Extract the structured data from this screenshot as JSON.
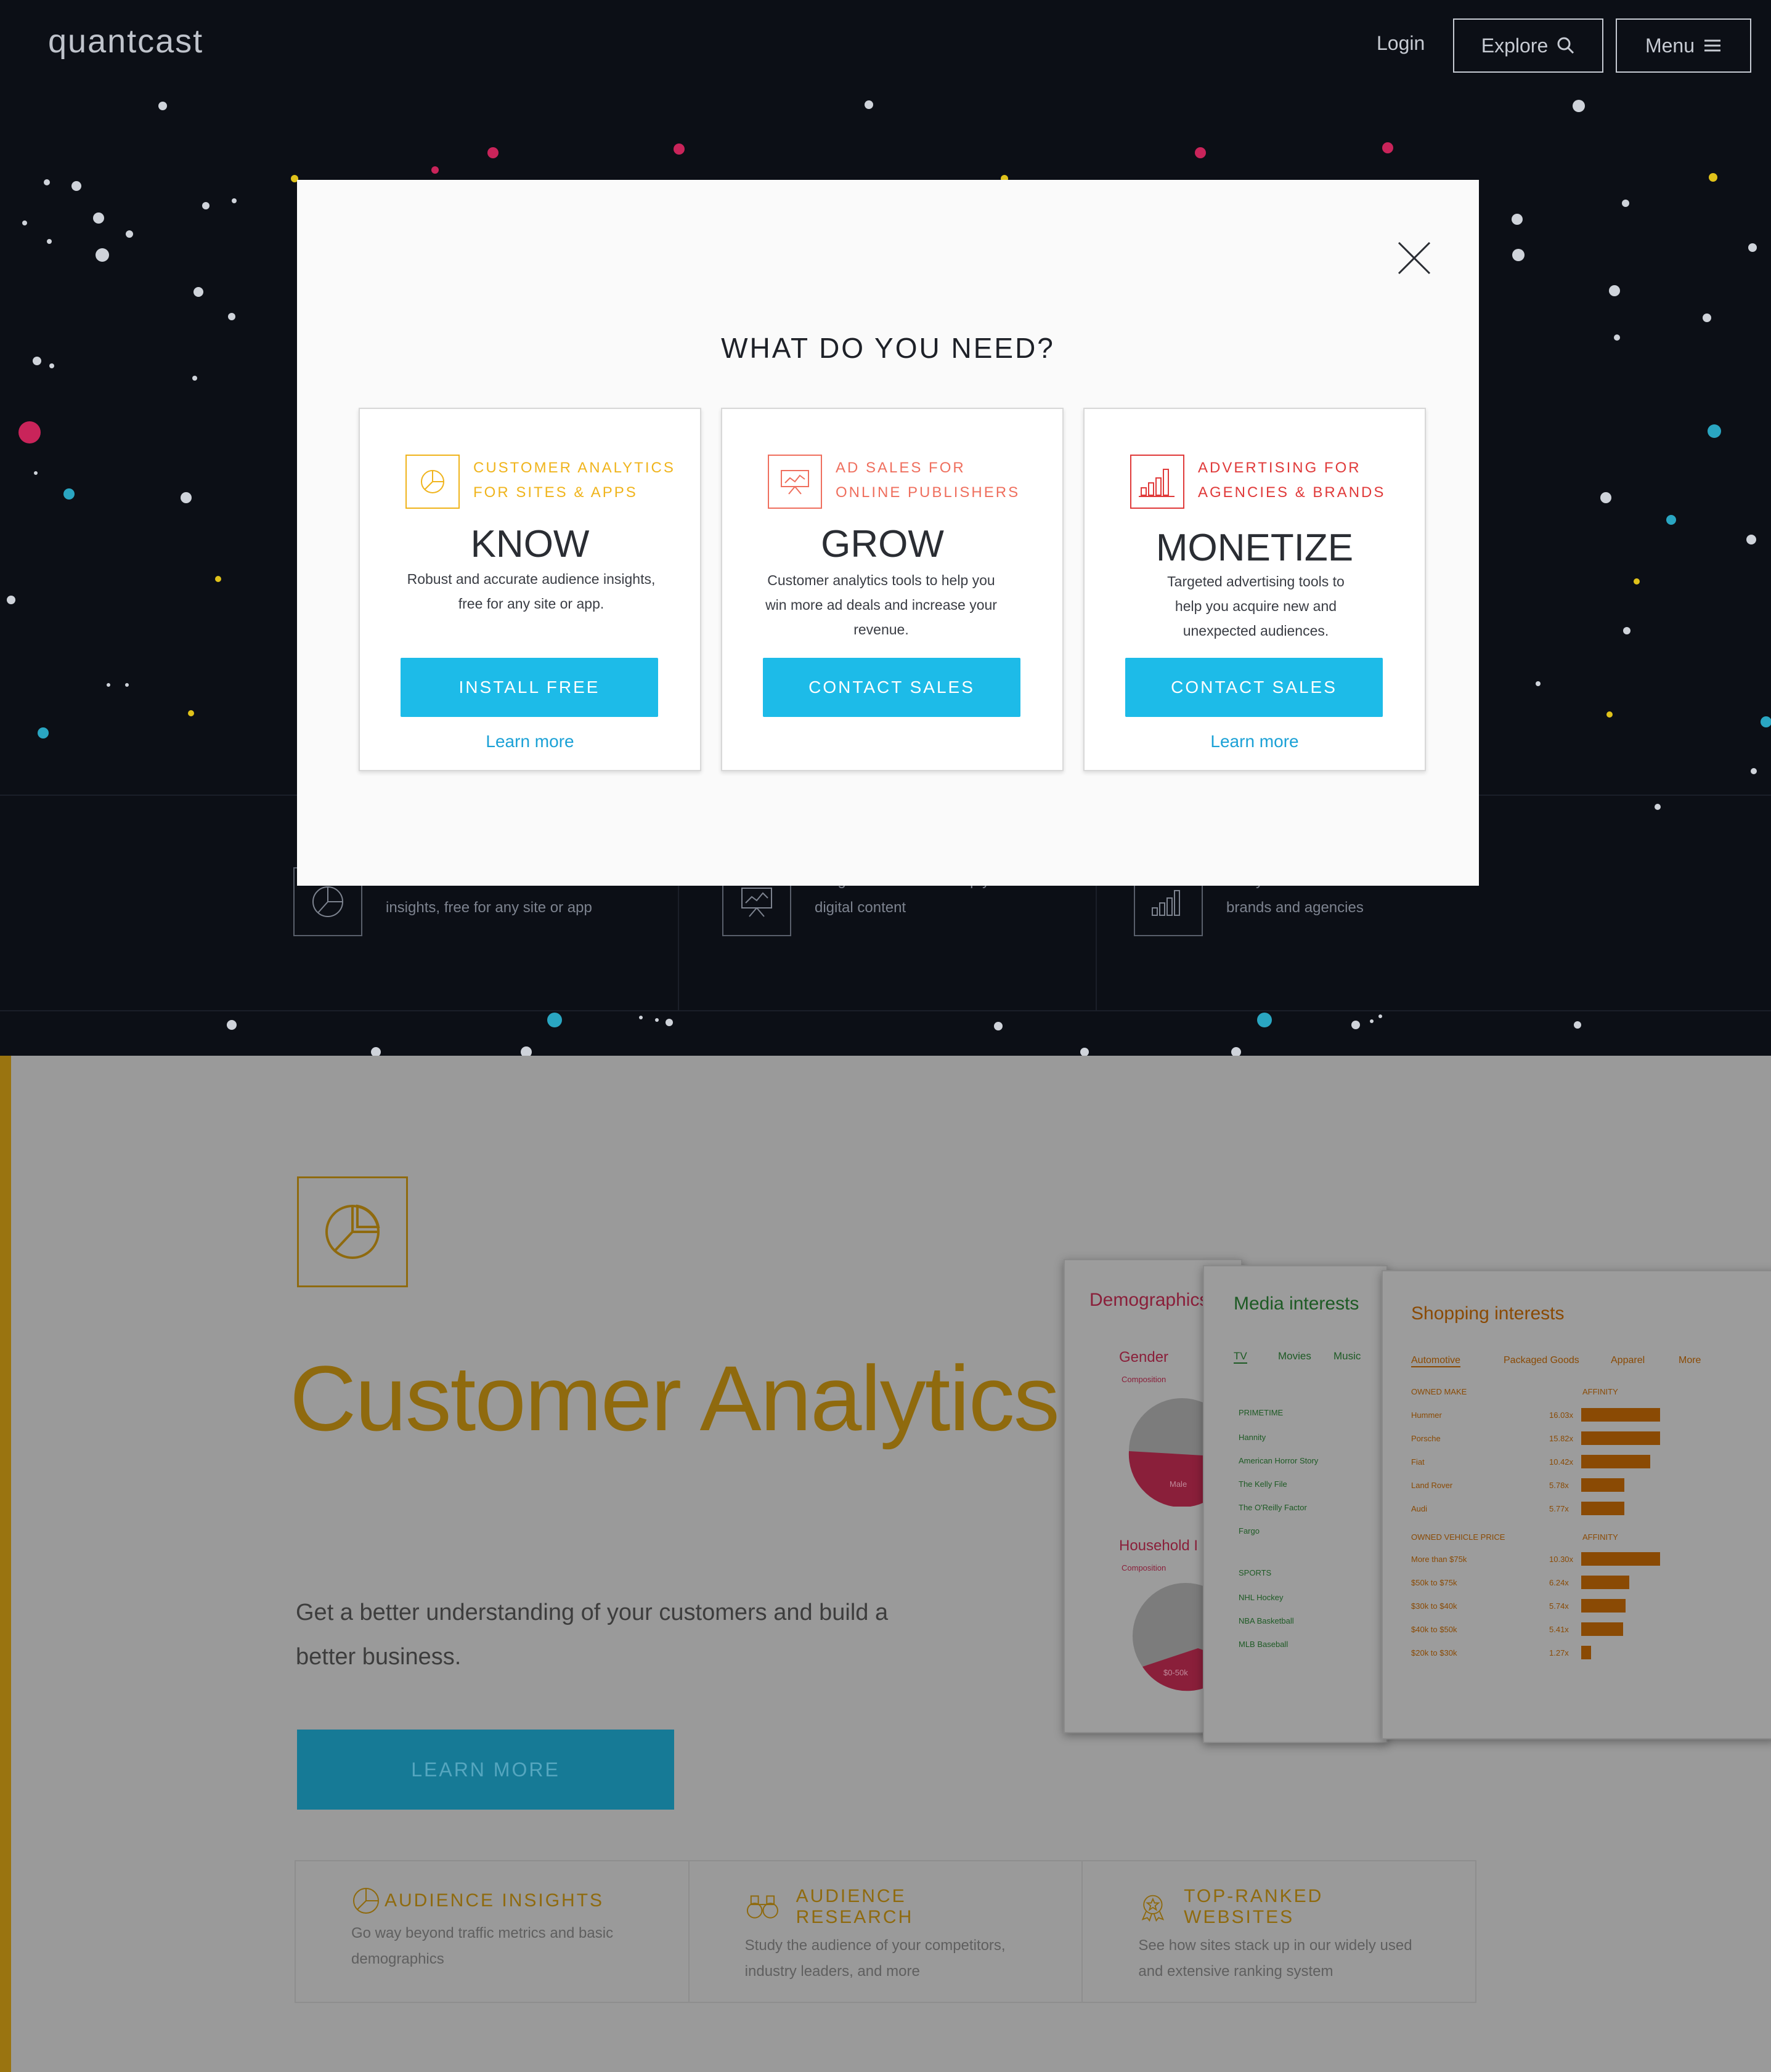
{
  "header": {
    "logo": "quantcast",
    "login": "Login",
    "explore": "Explore",
    "menu": "Menu"
  },
  "hero_features": [
    {
      "text": "Robust and accurate audience insights, free for any site or app"
    },
    {
      "text": "Insights and tools to help you monetize digital content"
    },
    {
      "text": "Analytics-driven ad distribution for brands and agencies"
    }
  ],
  "modal": {
    "title": "WHAT DO YOU NEED?",
    "cards": [
      {
        "category_line1": "CUSTOMER ANALYTICS",
        "category_line2": "FOR SITES & APPS",
        "word": "KNOW",
        "desc_line1": "Robust and accurate audience insights,",
        "desc_line2": "free for any site or app.",
        "desc_line3": "",
        "button": "INSTALL FREE",
        "learn": "Learn more",
        "color": "#f0b41c"
      },
      {
        "category_line1": "AD SALES FOR",
        "category_line2": "ONLINE PUBLISHERS",
        "word": "GROW",
        "desc_line1": "Customer analytics tools to help you",
        "desc_line2": "win more ad deals and increase your",
        "desc_line3": "revenue.",
        "button": "CONTACT SALES",
        "learn": "",
        "color": "#ef6f5e"
      },
      {
        "category_line1": "ADVERTISING FOR",
        "category_line2": "AGENCIES & BRANDS",
        "word": "MONETIZE",
        "desc_line1": "Targeted advertising tools to",
        "desc_line2": "help you acquire new and",
        "desc_line3": "unexpected audiences.",
        "button": "CONTACT SALES",
        "learn": "Learn more",
        "color": "#e03a3a"
      }
    ]
  },
  "customer_analytics": {
    "title": "Customer Analytics",
    "subtitle_line1": "Get a better understanding of your customers and build a",
    "subtitle_line2": "better business.",
    "button": "LEARN MORE",
    "features": [
      {
        "title": "AUDIENCE INSIGHTS",
        "desc_line1": "Go way beyond traffic metrics and basic",
        "desc_line2": "demographics"
      },
      {
        "title": "AUDIENCE RESEARCH",
        "desc_line1": "Study the audience of your competitors,",
        "desc_line2": "industry leaders, and more"
      },
      {
        "title": "TOP-RANKED WEBSITES",
        "desc_line1": "See how sites stack up in our widely used",
        "desc_line2": "and extensive ranking system"
      }
    ],
    "preview": {
      "demographics": {
        "title": "Demographics",
        "gender": "Gender",
        "composition": "Composition",
        "male": "Male",
        "household": "Household I",
        "composition2": "Composition",
        "income": "$0-50k"
      },
      "media": {
        "title": "Media interests",
        "tabs": [
          "TV",
          "Movies",
          "Music"
        ],
        "primetime": "PRIMETIME",
        "shows": [
          "Hannity",
          "American Horror Story",
          "The Kelly File",
          "The O'Reilly Factor",
          "Fargo"
        ],
        "sports": "SPORTS",
        "sport_items": [
          "NHL Hockey",
          "NBA Basketball",
          "MLB Baseball"
        ]
      },
      "shopping": {
        "title": "Shopping interests",
        "tabs": [
          "Automotive",
          "Packaged Goods",
          "Apparel",
          "More"
        ],
        "owned_make": "OWNED MAKE",
        "affinity": "AFFINITY",
        "makes": [
          "Hummer",
          "Porsche",
          "Fiat",
          "Land Rover",
          "Audi"
        ],
        "make_values": [
          "16.03x",
          "15.82x",
          "10.42x",
          "5.78x",
          "5.77x"
        ],
        "owned_price": "OWNED VEHICLE PRICE",
        "prices": [
          "More than $75k",
          "$50k to $75k",
          "$30k to $40k",
          "$40k to $50k",
          "$20k to $30k"
        ],
        "price_values": [
          "10.30x",
          "6.24x",
          "5.74x",
          "5.41x",
          "1.27x"
        ]
      }
    }
  }
}
